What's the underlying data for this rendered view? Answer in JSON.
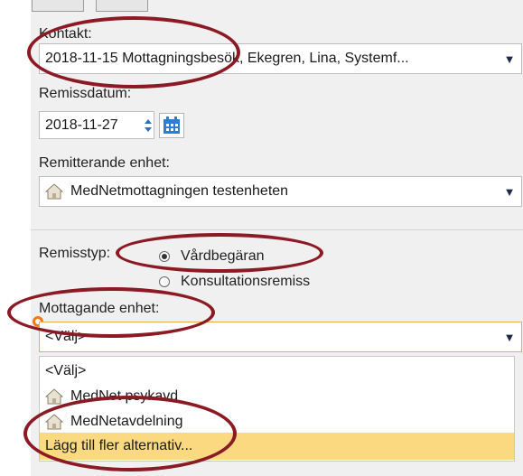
{
  "form": {
    "kontakt": {
      "label": "Kontakt:",
      "value": "2018-11-15 Mottagningsbesök, Ekegren, Lina, Systemf..."
    },
    "remissdatum": {
      "label": "Remissdatum:",
      "value": "2018-11-27"
    },
    "remitterande_enhet": {
      "label": "Remitterande enhet:",
      "value": "MedNetmottagningen testenheten"
    },
    "remisstyp": {
      "label": "Remisstyp:",
      "options": [
        {
          "label": "Vårdbegäran",
          "selected": true
        },
        {
          "label": "Konsultationsremiss",
          "selected": false
        }
      ]
    },
    "mottagande_enhet": {
      "label": "Mottagande enhet:",
      "value": "<Välj>",
      "dropdown_options": [
        {
          "label": "<Välj>",
          "icon": "",
          "highlighted": false
        },
        {
          "label": "MedNet psykavd",
          "icon": "home-icon",
          "highlighted": false
        },
        {
          "label": "MedNetavdelning",
          "icon": "home-icon",
          "highlighted": false
        },
        {
          "label": "Lägg till fler alternativ...",
          "icon": "",
          "highlighted": true
        }
      ]
    }
  },
  "colors": {
    "annotation": "#8b1a24",
    "highlight": "#fbd980",
    "focus_border": "#f2a94a",
    "required_marker": "#f07a18",
    "calendar_icon": "#2a7fd4",
    "dropdown_arrow": "#1b2a4a"
  }
}
